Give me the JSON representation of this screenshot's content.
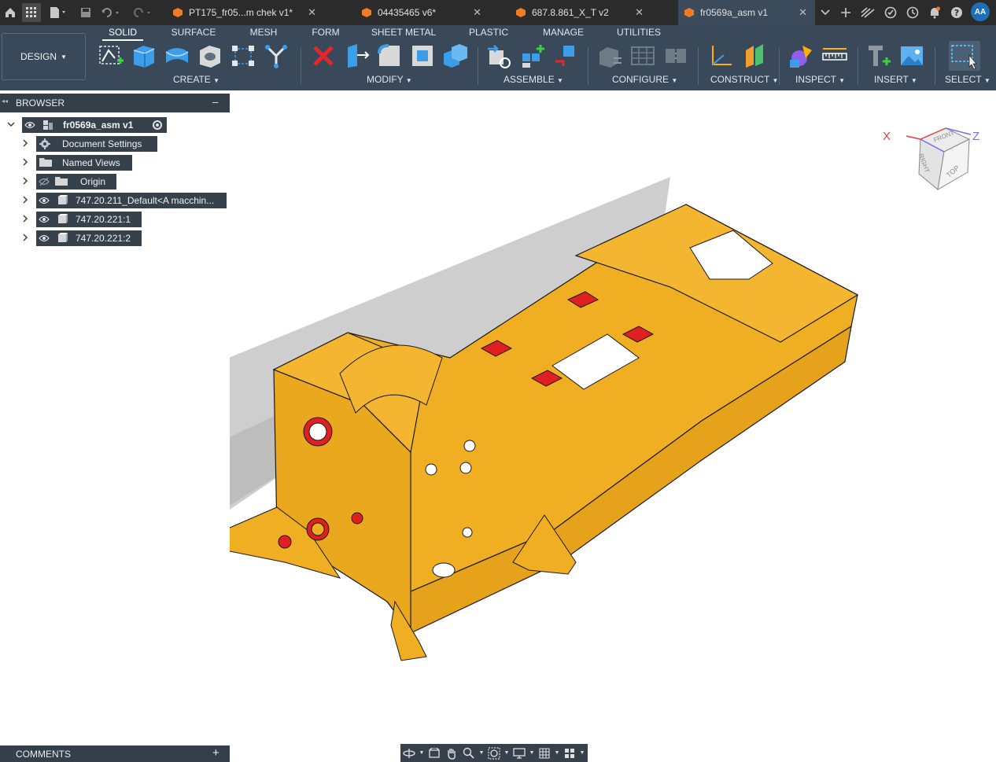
{
  "titlebar": {
    "tabs": [
      {
        "label": "PT175_fr05...m chek v1*",
        "active": false
      },
      {
        "label": "04435465 v6*",
        "active": false
      },
      {
        "label": "687.8.861_X_T v2",
        "active": false
      },
      {
        "label": "fr0569a_asm v1",
        "active": true
      }
    ],
    "close_glyph": "✕",
    "user_initials": "AA"
  },
  "ribbon": {
    "workspace": "DESIGN",
    "tabs": [
      "SOLID",
      "SURFACE",
      "MESH",
      "FORM",
      "SHEET METAL",
      "PLASTIC",
      "MANAGE",
      "UTILITIES"
    ],
    "active_tab": "SOLID",
    "groups": [
      "CREATE",
      "MODIFY",
      "ASSEMBLE",
      "CONFIGURE",
      "CONSTRUCT",
      "INSPECT",
      "INSERT",
      "SELECT"
    ]
  },
  "browser": {
    "title": "BROWSER",
    "collapse_glyph": "–",
    "root": "fr0569a_asm v1",
    "items": [
      {
        "label": "Document Settings",
        "icon": "gear-icon",
        "visible": null
      },
      {
        "label": "Named Views",
        "icon": "folder-icon",
        "visible": null
      },
      {
        "label": "Origin",
        "icon": "folder-icon",
        "visible": false
      },
      {
        "label": "747.20.211_Default<A macchin...",
        "icon": "component-icon",
        "visible": true
      },
      {
        "label": "747.20.221:1",
        "icon": "body-icon",
        "visible": true
      },
      {
        "label": "747.20.221:2",
        "icon": "body-icon",
        "visible": true
      }
    ]
  },
  "viewcube": {
    "front": "FRONT",
    "right": "RIGHT",
    "top": "TOP",
    "x_axis": "X",
    "z_axis": "Z"
  },
  "comments": {
    "title": "COMMENTS",
    "add_glyph": "+"
  },
  "colors": {
    "titlebar_bg": "#2b2b2b",
    "ribbon_bg": "#39495a",
    "panel_bg": "#343f4a",
    "model_body": "#f0ae22",
    "model_edge": "#1a1a1a",
    "red_parts": "#e02020"
  }
}
